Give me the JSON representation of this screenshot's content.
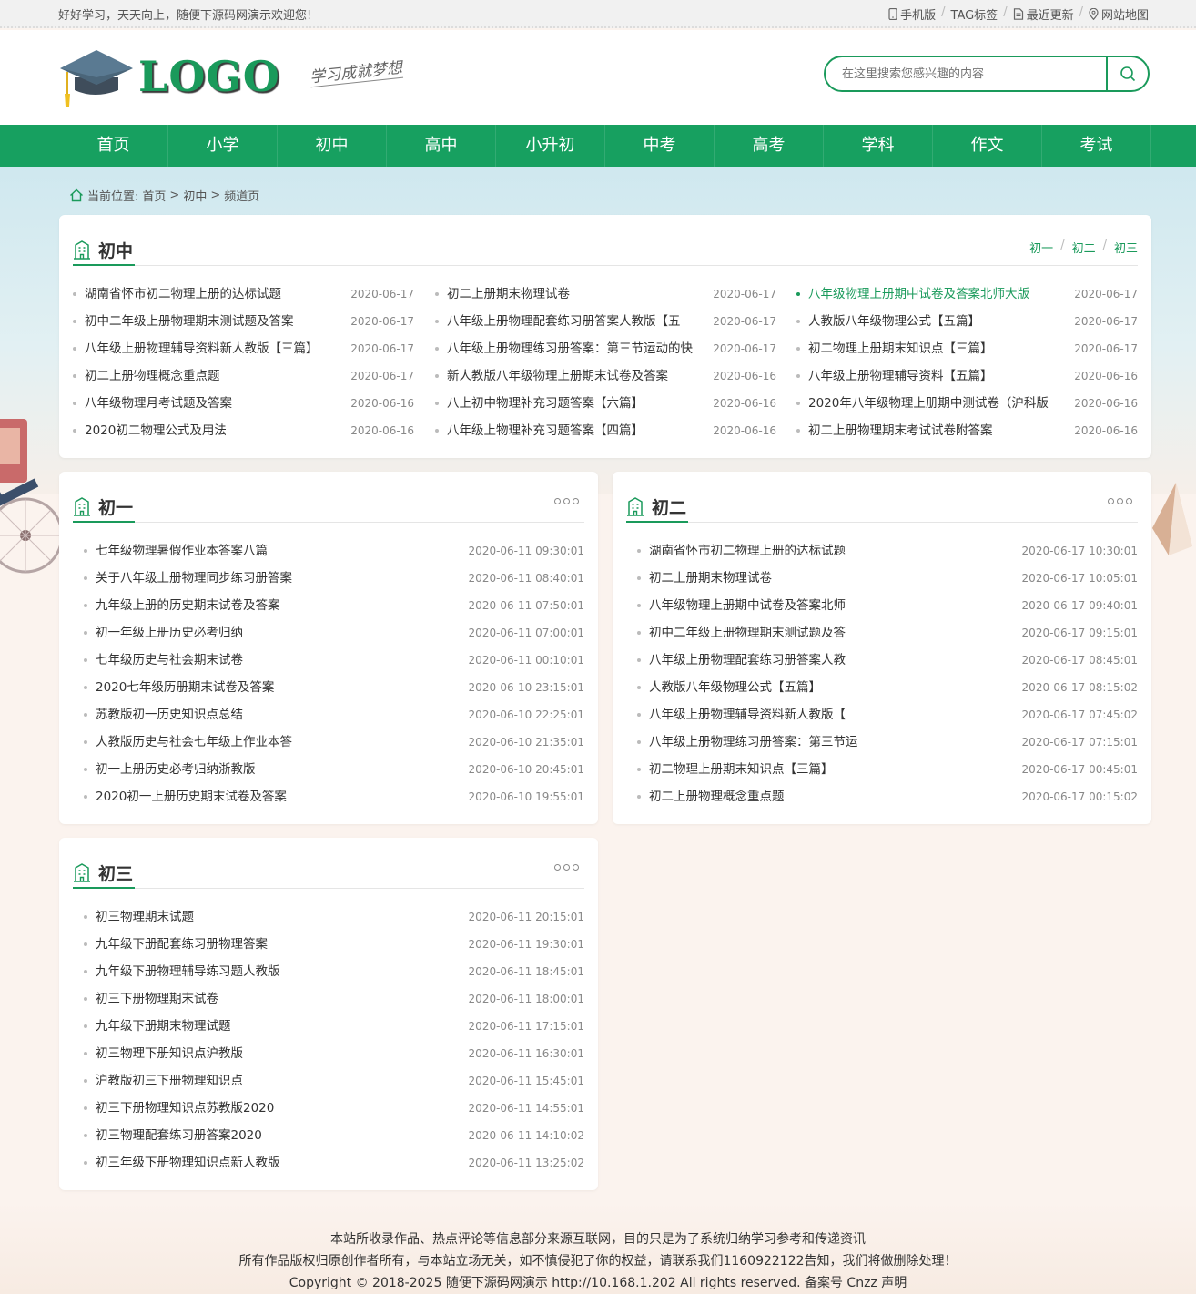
{
  "topbar": {
    "welcome": "好好学习，天天向上，随便下源码网演示欢迎您!",
    "links": [
      {
        "label": "手机版",
        "icon": "mobile-icon"
      },
      {
        "label": "TAG标签",
        "icon": ""
      },
      {
        "label": "最近更新",
        "icon": "document-icon"
      },
      {
        "label": "网站地图",
        "icon": "map-pin-icon"
      }
    ]
  },
  "header": {
    "logo_text": "LOGO",
    "slogan": "学习成就梦想",
    "search": {
      "placeholder": "在这里搜索您感兴趣的内容",
      "icon": "search-icon"
    }
  },
  "nav": [
    "首页",
    "小学",
    "初中",
    "高中",
    "小升初",
    "中考",
    "高考",
    "学科",
    "作文",
    "考试"
  ],
  "breadcrumb": {
    "prefix": "当前位置:",
    "items": [
      "首页",
      "初中",
      "频道页"
    ],
    "sep": ">"
  },
  "main_panel": {
    "title": "初中",
    "tabs": [
      "初一",
      "初二",
      "初三"
    ],
    "columns": [
      [
        {
          "title": "湖南省怀市初二物理上册的达标试题",
          "date": "2020-06-17"
        },
        {
          "title": "初中二年级上册物理期末测试题及答案",
          "date": "2020-06-17"
        },
        {
          "title": "八年级上册物理辅导资料新人教版【三篇】",
          "date": "2020-06-17"
        },
        {
          "title": "初二上册物理概念重点题",
          "date": "2020-06-17"
        },
        {
          "title": "八年级物理月考试题及答案",
          "date": "2020-06-16"
        },
        {
          "title": "2020初二物理公式及用法",
          "date": "2020-06-16"
        }
      ],
      [
        {
          "title": "初二上册期末物理试卷",
          "date": "2020-06-17"
        },
        {
          "title": "八年级上册物理配套练习册答案人教版【五",
          "date": "2020-06-17"
        },
        {
          "title": "八年级上册物理练习册答案：第三节运动的快",
          "date": "2020-06-17"
        },
        {
          "title": "新人教版八年级物理上册期末试卷及答案",
          "date": "2020-06-16"
        },
        {
          "title": "八上初中物理补充习题答案【六篇】",
          "date": "2020-06-16"
        },
        {
          "title": "八年级上物理补充习题答案【四篇】",
          "date": "2020-06-16"
        }
      ],
      [
        {
          "title": "八年级物理上册期中试卷及答案北师大版",
          "date": "2020-06-17",
          "highlight": true
        },
        {
          "title": "人教版八年级物理公式【五篇】",
          "date": "2020-06-17"
        },
        {
          "title": "初二物理上册期末知识点【三篇】",
          "date": "2020-06-17"
        },
        {
          "title": "八年级上册物理辅导资料【五篇】",
          "date": "2020-06-16"
        },
        {
          "title": "2020年八年级物理上册期中测试卷（沪科版",
          "date": "2020-06-16"
        },
        {
          "title": "初二上册物理期末考试试卷附答案",
          "date": "2020-06-16"
        }
      ]
    ]
  },
  "panels": [
    {
      "title": "初一",
      "items": [
        {
          "title": "七年级物理暑假作业本答案八篇",
          "date": "2020-06-11 09:30:01"
        },
        {
          "title": "关于八年级上册物理同步练习册答案",
          "date": "2020-06-11 08:40:01"
        },
        {
          "title": "九年级上册的历史期末试卷及答案",
          "date": "2020-06-11 07:50:01"
        },
        {
          "title": "初一年级上册历史必考归纳",
          "date": "2020-06-11 07:00:01"
        },
        {
          "title": "七年级历史与社会期末试卷",
          "date": "2020-06-11 00:10:01"
        },
        {
          "title": "2020七年级历册期末试卷及答案",
          "date": "2020-06-10 23:15:01"
        },
        {
          "title": "苏教版初一历史知识点总结",
          "date": "2020-06-10 22:25:01"
        },
        {
          "title": "人教版历史与社会七年级上作业本答",
          "date": "2020-06-10 21:35:01"
        },
        {
          "title": "初一上册历史必考归纳浙教版",
          "date": "2020-06-10 20:45:01"
        },
        {
          "title": "2020初一上册历史期末试卷及答案",
          "date": "2020-06-10 19:55:01"
        }
      ]
    },
    {
      "title": "初二",
      "items": [
        {
          "title": "湖南省怀市初二物理上册的达标试题",
          "date": "2020-06-17 10:30:01"
        },
        {
          "title": "初二上册期末物理试卷",
          "date": "2020-06-17 10:05:01"
        },
        {
          "title": "八年级物理上册期中试卷及答案北师",
          "date": "2020-06-17 09:40:01"
        },
        {
          "title": "初中二年级上册物理期末测试题及答",
          "date": "2020-06-17 09:15:01"
        },
        {
          "title": "八年级上册物理配套练习册答案人教",
          "date": "2020-06-17 08:45:01"
        },
        {
          "title": "人教版八年级物理公式【五篇】",
          "date": "2020-06-17 08:15:02"
        },
        {
          "title": "八年级上册物理辅导资料新人教版【",
          "date": "2020-06-17 07:45:02"
        },
        {
          "title": "八年级上册物理练习册答案：第三节运",
          "date": "2020-06-17 07:15:01"
        },
        {
          "title": "初二物理上册期末知识点【三篇】",
          "date": "2020-06-17 00:45:01"
        },
        {
          "title": "初二上册物理概念重点题",
          "date": "2020-06-17 00:15:02"
        }
      ]
    },
    {
      "title": "初三",
      "items": [
        {
          "title": "初三物理期末试题",
          "date": "2020-06-11 20:15:01"
        },
        {
          "title": "九年级下册配套练习册物理答案",
          "date": "2020-06-11 19:30:01"
        },
        {
          "title": "九年级下册物理辅导练习题人教版",
          "date": "2020-06-11 18:45:01"
        },
        {
          "title": "初三下册物理期末试卷",
          "date": "2020-06-11 18:00:01"
        },
        {
          "title": "九年级下册期末物理试题",
          "date": "2020-06-11 17:15:01"
        },
        {
          "title": "初三物理下册知识点沪教版",
          "date": "2020-06-11 16:30:01"
        },
        {
          "title": "沪教版初三下册物理知识点",
          "date": "2020-06-11 15:45:01"
        },
        {
          "title": "初三下册物理知识点苏教版2020",
          "date": "2020-06-11 14:55:01"
        },
        {
          "title": "初三物理配套练习册答案2020",
          "date": "2020-06-11 14:10:02"
        },
        {
          "title": "初三年级下册物理知识点新人教版",
          "date": "2020-06-11 13:25:02"
        }
      ]
    }
  ],
  "footer": [
    "本站所收录作品、热点评论等信息部分来源互联网，目的只是为了系统归纳学习参考和传递资讯",
    "所有作品版权归原创作者所有，与本站立场无关，如不慎侵犯了你的权益，请联系我们1160922122告知，我们将做删除处理！",
    "Copyright © 2018-2025 随便下源码网演示 http://10.168.1.202 All rights reserved. 备案号 Cnzz 声明"
  ],
  "colors": {
    "accent": "#17a060",
    "text": "#333333",
    "date": "#888888"
  }
}
